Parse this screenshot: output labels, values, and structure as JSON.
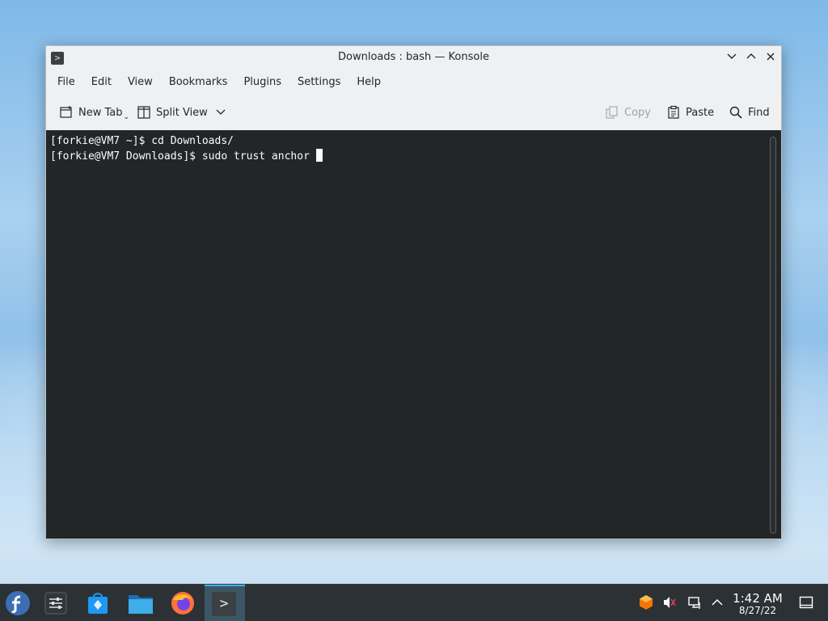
{
  "window": {
    "title": "Downloads : bash — Konsole",
    "controls": [
      "minimize",
      "maximize",
      "close"
    ]
  },
  "menubar": {
    "items": [
      "File",
      "Edit",
      "View",
      "Bookmarks",
      "Plugins",
      "Settings",
      "Help"
    ]
  },
  "toolbar": {
    "new_tab": "New Tab",
    "split_view": "Split View",
    "copy": "Copy",
    "paste": "Paste",
    "find": "Find"
  },
  "terminal": {
    "lines": [
      "[forkie@VM7 ~]$ cd Downloads/",
      "[forkie@VM7 Downloads]$ sudo trust anchor"
    ],
    "background": "#232627",
    "foreground": "#fcfcfc"
  },
  "taskbar": {
    "launchers": [
      "fedora-icon",
      "system-settings-icon",
      "discover-store-icon",
      "file-manager-icon",
      "firefox-icon",
      "konsole-icon"
    ],
    "active_task": "Konsole",
    "tray": [
      "software-update-icon",
      "volume-muted-icon",
      "network-icon",
      "tray-expand-icon"
    ],
    "time": "1:42 AM",
    "date": "8/27/22",
    "accent": "#3daee9"
  }
}
